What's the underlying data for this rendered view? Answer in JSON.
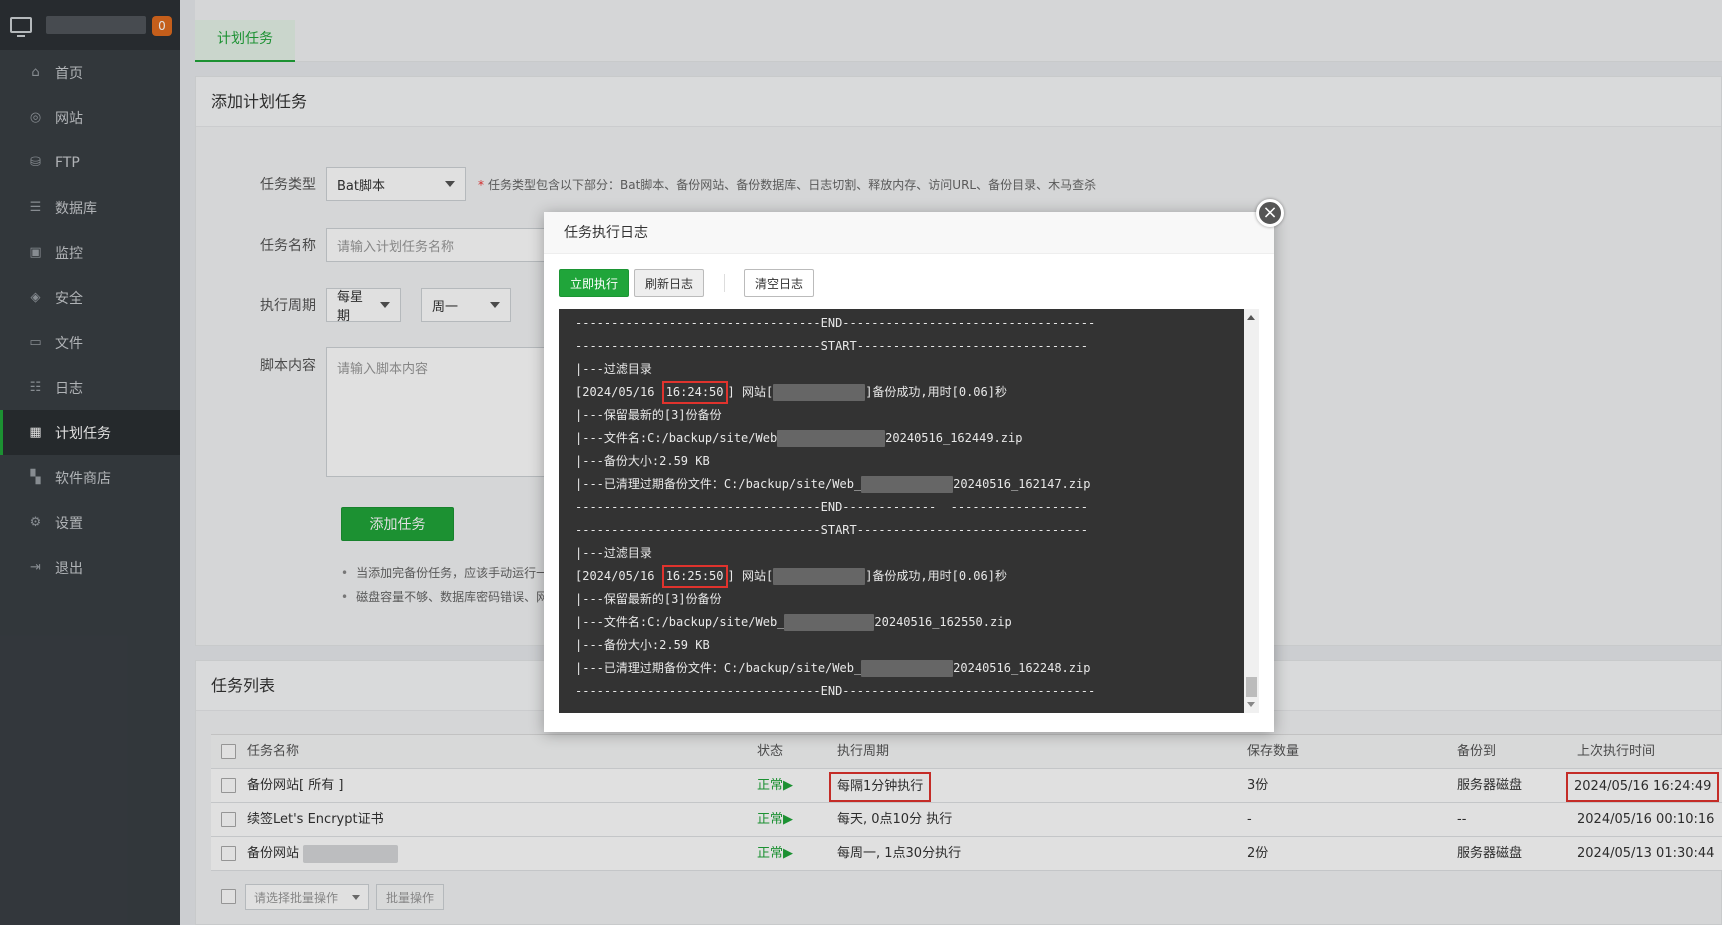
{
  "sidebar": {
    "badge": "0",
    "items": [
      {
        "label": "首页",
        "icon": "home-icon"
      },
      {
        "label": "网站",
        "icon": "globe-icon"
      },
      {
        "label": "FTP",
        "icon": "ftp-icon"
      },
      {
        "label": "数据库",
        "icon": "database-icon"
      },
      {
        "label": "监控",
        "icon": "monitor-icon"
      },
      {
        "label": "安全",
        "icon": "shield-icon"
      },
      {
        "label": "文件",
        "icon": "folder-icon"
      },
      {
        "label": "日志",
        "icon": "log-icon"
      },
      {
        "label": "计划任务",
        "icon": "calendar-icon"
      },
      {
        "label": "软件商店",
        "icon": "apps-icon"
      },
      {
        "label": "设置",
        "icon": "gear-icon"
      },
      {
        "label": "退出",
        "icon": "logout-icon"
      }
    ]
  },
  "tab": {
    "label": "计划任务"
  },
  "add_panel": {
    "title": "添加计划任务",
    "task_type_label": "任务类型",
    "task_type_value": "Bat脚本",
    "task_type_hint": "任务类型包含以下部分：Bat脚本、备份网站、备份数据库、日志切割、释放内存、访问URL、备份目录、木马查杀",
    "task_name_label": "任务名称",
    "task_name_placeholder": "请输入计划任务名称",
    "cycle_label": "执行周期",
    "cycle_value": "每星期",
    "cycle_day": "周一",
    "script_label": "脚本内容",
    "script_placeholder": "请输入脚本内容",
    "add_button": "添加任务",
    "notes": [
      "当添加完备份任务，应该手动运行一",
      "磁盘容量不够、数据库密码错误、网"
    ]
  },
  "list_panel": {
    "title": "任务列表",
    "columns": [
      "任务名称",
      "状态",
      "执行周期",
      "保存数量",
      "备份到",
      "上次执行时间"
    ],
    "rows": [
      {
        "name": "备份网站[ 所有 ]",
        "status": "正常▶",
        "cycle": "每隔1分钟执行",
        "keep": "3份",
        "target": "服务器磁盘",
        "last": "2024/05/16 16:24:49"
      },
      {
        "name": "续签Let's Encrypt证书",
        "status": "正常▶",
        "cycle": "每天, 0点10分 执行",
        "keep": "-",
        "target": "--",
        "last": "2024/05/16 00:10:16"
      },
      {
        "name": "备份网站",
        "status": "正常▶",
        "cycle": "每周一, 1点30分执行",
        "keep": "2份",
        "target": "服务器磁盘",
        "last": "2024/05/13 01:30:44"
      }
    ],
    "batch_placeholder": "请选择批量操作",
    "batch_button": "批量操作"
  },
  "modal": {
    "title": "任务执行日志",
    "close": "×",
    "exec_button": "立即执行",
    "refresh_button": "刷新日志",
    "clear_button": "清空日志",
    "log": {
      "end": "----------------------------------END-----------------------------------",
      "end_gap": "----------------------------------END-------------  -------------------",
      "start": "----------------------------------START--------------------------------",
      "filter": "|---过滤目录",
      "b1_date": "[2024/05/16 ",
      "b1_time": "16:24:50",
      "b1_site": "] 网站[",
      "b1_ok": "]备份成功,用时[0.06]秒",
      "keep": "|---保留最新的[3]份备份",
      "b1_file_pre": "|---文件名:C:/backup/site/Web",
      "b1_file_suf": "20240516_162449.zip",
      "size": "|---备份大小:2.59 KB",
      "clean_pre": "|---已清理过期备份文件：C:/backup/site/Web_",
      "b1_clean_suf": "20240516_162147.zip",
      "b2_time": "16:25:50",
      "b2_file_pre": "|---文件名:C:/backup/site/Web_",
      "b2_file_suf": "20240516_162550.zip",
      "b2_clean_suf": "20240516_162248.zip"
    }
  },
  "colors": {
    "accent": "#20a53a",
    "highlight": "#e0332d",
    "sidebar": "#3a3f44"
  }
}
